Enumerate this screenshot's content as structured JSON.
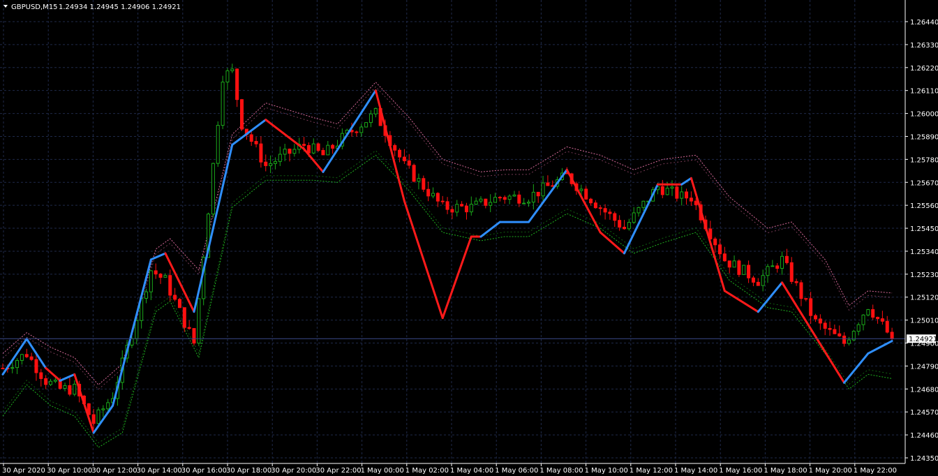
{
  "header": {
    "symbol": "GBPUSD,M15",
    "quote": "1.24934 1.24945 1.24906 1.24921"
  },
  "colors": {
    "background": "#000000",
    "grid": "#1f2a4a",
    "bull_candle": "#1aa81a",
    "bear_candle": "#ff1010",
    "trend_up": "#2f8fff",
    "trend_down": "#ff1a1a",
    "band_upper": "#d86a9a",
    "band_lower": "#1fb51f",
    "price_line": "#3a4a8a"
  },
  "current_price_label": "1.24921",
  "chart_data": {
    "type": "candlestick",
    "title": "GBPUSD,M15",
    "ylim": [
      1.2435,
      1.2644
    ],
    "y_ticks": [
      "1.26440",
      "1.26330",
      "1.26220",
      "1.26110",
      "1.26000",
      "1.25890",
      "1.25780",
      "1.25670",
      "1.25560",
      "1.25450",
      "1.25340",
      "1.25230",
      "1.25120",
      "1.25010",
      "1.24900",
      "1.24790",
      "1.24680",
      "1.24570",
      "1.24460",
      "1.24350"
    ],
    "x_ticks": [
      "30 Apr 2020",
      "30 Apr 10:00",
      "30 Apr 12:00",
      "30 Apr 14:00",
      "30 Apr 16:00",
      "30 Apr 18:00",
      "30 Apr 20:00",
      "30 Apr 22:00",
      "1 May 00:00",
      "1 May 02:00",
      "1 May 04:00",
      "1 May 06:00",
      "1 May 08:00",
      "1 May 10:00",
      "1 May 12:00",
      "1 May 14:00",
      "1 May 16:00",
      "1 May 18:00",
      "1 May 20:00",
      "1 May 22:00"
    ],
    "current_price": 1.24921,
    "trend_path": [
      [
        0,
        1.2475,
        "up"
      ],
      [
        5,
        1.2492,
        "up"
      ],
      [
        9,
        1.2478,
        "down"
      ],
      [
        12,
        1.2472,
        "up"
      ],
      [
        15,
        1.2475,
        "down"
      ],
      [
        19,
        1.2447,
        "up"
      ],
      [
        23,
        1.246,
        "up"
      ],
      [
        31,
        1.253,
        "up"
      ],
      [
        34,
        1.2533,
        "down"
      ],
      [
        40,
        1.2505,
        "up"
      ],
      [
        48,
        1.2585,
        "up"
      ],
      [
        55,
        1.2597,
        "down"
      ],
      [
        63,
        1.2583,
        "down"
      ],
      [
        67,
        1.2572,
        "up"
      ],
      [
        78,
        1.2611,
        "down"
      ],
      [
        84,
        1.2558,
        "down"
      ],
      [
        92,
        1.2502,
        "down"
      ],
      [
        98,
        1.2541,
        "down"
      ],
      [
        100,
        1.2541,
        "up"
      ],
      [
        104,
        1.2548,
        "up"
      ],
      [
        110,
        1.2548,
        "up"
      ],
      [
        118,
        1.2573,
        "down"
      ],
      [
        125,
        1.2543,
        "down"
      ],
      [
        130,
        1.2533,
        "up"
      ],
      [
        137,
        1.2566,
        "down"
      ],
      [
        142,
        1.2566,
        "up"
      ],
      [
        144,
        1.2569,
        "down"
      ],
      [
        151,
        1.2515,
        "down"
      ],
      [
        158,
        1.2505,
        "up"
      ],
      [
        163,
        1.2519,
        "down"
      ],
      [
        176,
        1.2471,
        "up"
      ],
      [
        181,
        1.2485,
        "up"
      ],
      [
        186,
        1.2491,
        "up"
      ]
    ],
    "candle_anchors": [
      [
        0,
        1.2478
      ],
      [
        5,
        1.2485
      ],
      [
        9,
        1.2472
      ],
      [
        12,
        1.2468
      ],
      [
        15,
        1.2468
      ],
      [
        19,
        1.2452
      ],
      [
        23,
        1.2465
      ],
      [
        31,
        1.2525
      ],
      [
        34,
        1.252
      ],
      [
        40,
        1.249
      ],
      [
        46,
        1.2618
      ],
      [
        48,
        1.262
      ],
      [
        50,
        1.2595
      ],
      [
        55,
        1.2575
      ],
      [
        63,
        1.2585
      ],
      [
        67,
        1.258
      ],
      [
        72,
        1.259
      ],
      [
        78,
        1.26
      ],
      [
        84,
        1.2575
      ],
      [
        92,
        1.2555
      ],
      [
        98,
        1.2555
      ],
      [
        104,
        1.256
      ],
      [
        110,
        1.256
      ],
      [
        118,
        1.257
      ],
      [
        125,
        1.2555
      ],
      [
        130,
        1.2545
      ],
      [
        137,
        1.2565
      ],
      [
        142,
        1.256
      ],
      [
        144,
        1.256
      ],
      [
        151,
        1.253
      ],
      [
        158,
        1.252
      ],
      [
        163,
        1.253
      ],
      [
        170,
        1.25
      ],
      [
        176,
        1.249
      ],
      [
        181,
        1.2508
      ],
      [
        186,
        1.2492
      ]
    ],
    "upper_band": [
      [
        0,
        1.2485
      ],
      [
        5,
        1.2495
      ],
      [
        10,
        1.2488
      ],
      [
        15,
        1.2483
      ],
      [
        20,
        1.247
      ],
      [
        25,
        1.248
      ],
      [
        32,
        1.2535
      ],
      [
        35,
        1.254
      ],
      [
        41,
        1.2525
      ],
      [
        48,
        1.259
      ],
      [
        55,
        1.2605
      ],
      [
        65,
        1.2598
      ],
      [
        70,
        1.2595
      ],
      [
        78,
        1.2615
      ],
      [
        85,
        1.2598
      ],
      [
        92,
        1.2578
      ],
      [
        100,
        1.2572
      ],
      [
        105,
        1.2573
      ],
      [
        110,
        1.2573
      ],
      [
        118,
        1.2584
      ],
      [
        125,
        1.258
      ],
      [
        132,
        1.2573
      ],
      [
        138,
        1.2578
      ],
      [
        145,
        1.258
      ],
      [
        152,
        1.256
      ],
      [
        160,
        1.2545
      ],
      [
        165,
        1.2548
      ],
      [
        172,
        1.253
      ],
      [
        177,
        1.2508
      ],
      [
        181,
        1.2515
      ],
      [
        186,
        1.2514
      ]
    ],
    "lower_band": [
      [
        0,
        1.2455
      ],
      [
        5,
        1.247
      ],
      [
        10,
        1.246
      ],
      [
        15,
        1.2455
      ],
      [
        20,
        1.244
      ],
      [
        25,
        1.2447
      ],
      [
        32,
        1.2505
      ],
      [
        35,
        1.251
      ],
      [
        41,
        1.2483
      ],
      [
        48,
        1.2555
      ],
      [
        55,
        1.2568
      ],
      [
        65,
        1.2568
      ],
      [
        70,
        1.2567
      ],
      [
        78,
        1.258
      ],
      [
        85,
        1.2563
      ],
      [
        92,
        1.2543
      ],
      [
        100,
        1.2539
      ],
      [
        105,
        1.2541
      ],
      [
        110,
        1.2541
      ],
      [
        118,
        1.2552
      ],
      [
        125,
        1.2545
      ],
      [
        132,
        1.2533
      ],
      [
        138,
        1.2538
      ],
      [
        145,
        1.2543
      ],
      [
        152,
        1.252
      ],
      [
        160,
        1.2507
      ],
      [
        165,
        1.2505
      ],
      [
        172,
        1.2485
      ],
      [
        177,
        1.2468
      ],
      [
        181,
        1.2475
      ],
      [
        186,
        1.2473
      ]
    ]
  }
}
